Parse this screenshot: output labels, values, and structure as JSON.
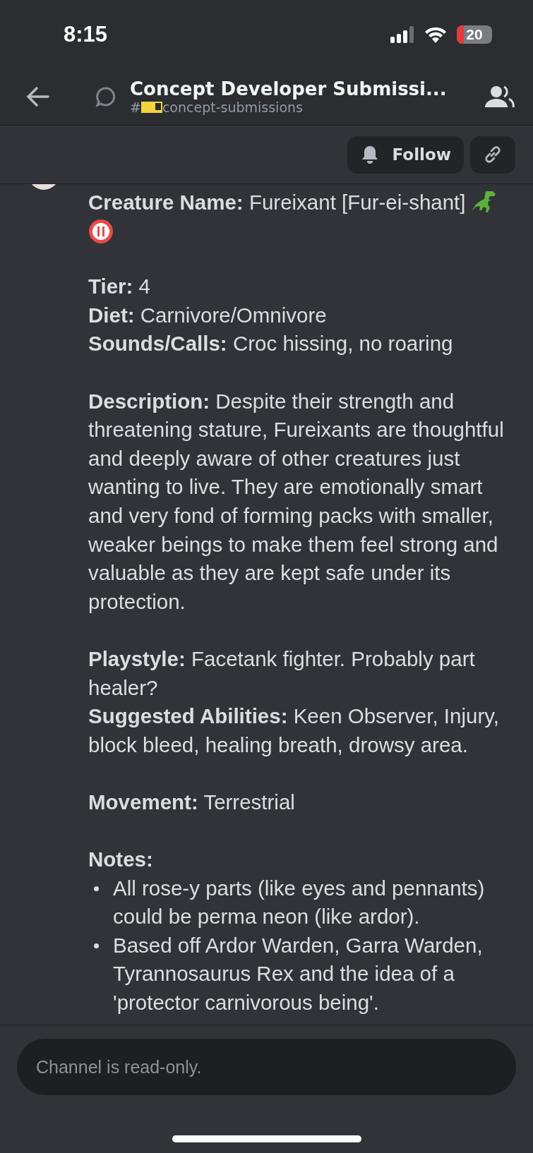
{
  "status_bar": {
    "time": "8:15",
    "battery": "20"
  },
  "header": {
    "title": "Concept Developer Submissi...",
    "hash": "#",
    "channel": "concept-submissions"
  },
  "actions": {
    "follow": "Follow"
  },
  "message": {
    "blocks": [
      {
        "kind": "lines",
        "lines": [
          {
            "label": "Creature Name:",
            "text": "Fureixant [Fur-ei-shant]",
            "emoji": true
          }
        ]
      },
      {
        "kind": "lines",
        "lines": [
          {
            "label": "Tier:",
            "text": "4"
          },
          {
            "label": "Diet:",
            "text": "Carnivore/Omnivore"
          },
          {
            "label": "Sounds/Calls:",
            "text": "Croc hissing, no roaring"
          }
        ]
      },
      {
        "kind": "lines",
        "lines": [
          {
            "label": "Description:",
            "text": "Despite their strength and threatening stature, Fureixants are thoughtful and deeply aware of other creatures just wanting to live. They are emotionally smart and very fond of forming packs with smaller, weaker beings to make them feel strong and valuable as they are kept safe under its protection."
          }
        ]
      },
      {
        "kind": "lines",
        "lines": [
          {
            "label": "Playstyle:",
            "text": "Facetank fighter. Probably part healer?"
          },
          {
            "label": "Suggested Abilities:",
            "text": "Keen Observer, Injury, block bleed, healing breath, drowsy area."
          }
        ]
      },
      {
        "kind": "lines",
        "lines": [
          {
            "label": "Movement:",
            "text": "Terrestrial"
          }
        ]
      },
      {
        "kind": "bullets",
        "heading": "Notes:",
        "items": [
          "All rose-y parts (like eyes and pennants) could be perma neon (like ardor).",
          "Based off Ardor Warden, Garra Warden, Tyrannosaurus Rex and the idea of a 'protector carnivorous being'."
        ]
      }
    ]
  },
  "composer": {
    "placeholder": "Channel is read-only."
  }
}
